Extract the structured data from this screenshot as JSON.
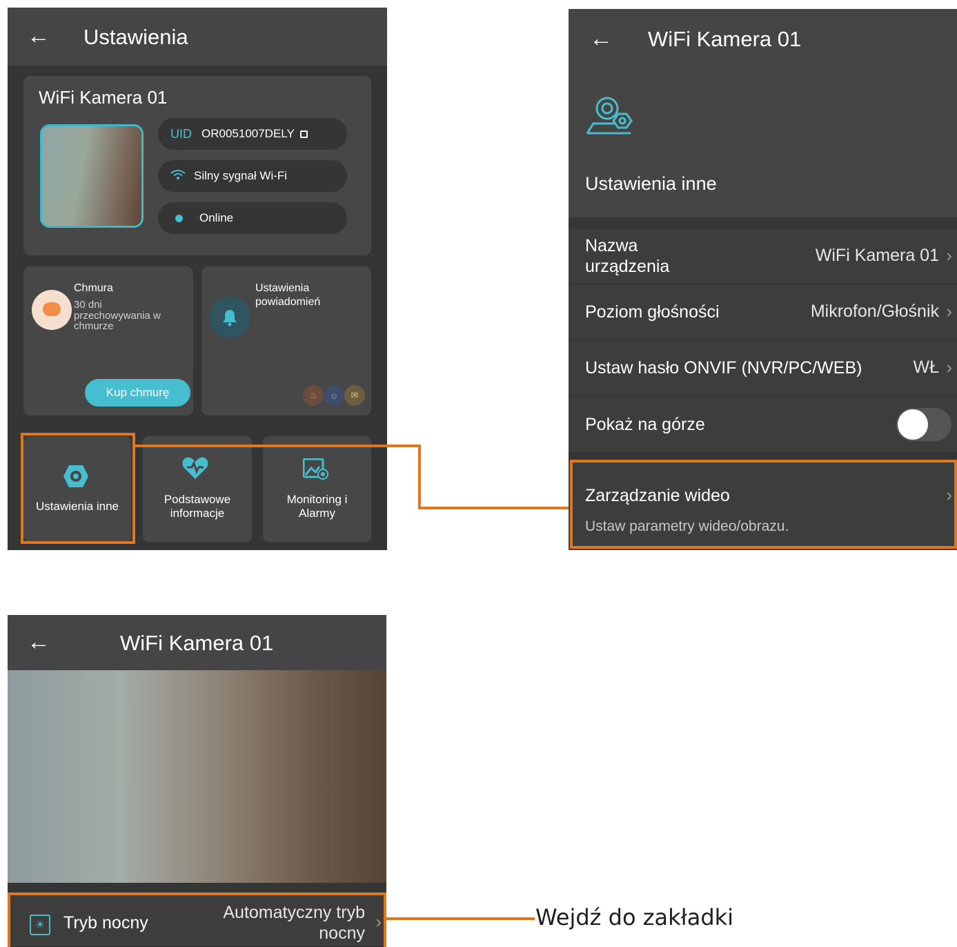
{
  "panel_settings": {
    "title": "Ustawienia",
    "device_name": "WiFi Kamera 01",
    "uid_label": "UID",
    "uid_value": "OR0051007DELY",
    "wifi_status": "Silny sygnał Wi-Fi",
    "online_status": "Online",
    "cloud_title": "Chmura",
    "cloud_desc_1": "30 dni",
    "cloud_desc_2": "przechowywania w",
    "cloud_desc_3": "chmurze",
    "buy_cloud": "Kup chmurę",
    "notif_title_1": "Ustawienia",
    "notif_title_2": "powiadomień",
    "tiles": [
      {
        "label_1": "Ustawienia inne",
        "label_2": ""
      },
      {
        "label_1": "Podstawowe",
        "label_2": "informacje"
      },
      {
        "label_1": "Monitoring i",
        "label_2": "Alarmy"
      }
    ]
  },
  "panel_other": {
    "title": "WiFi Kamera 01",
    "section_title": "Ustawienia inne",
    "rows": [
      {
        "label_1": "Nazwa",
        "label_2": "urządzenia",
        "value": "WiFi Kamera 01"
      },
      {
        "label": "Poziom głośności",
        "value": "Mikrofon/Głośnik"
      },
      {
        "label": "Ustaw hasło ONVIF (NVR/PC/WEB)",
        "value": "WŁ"
      },
      {
        "label": "Pokaż na górze",
        "toggle_on": false
      }
    ],
    "video_mgmt": {
      "label": "Zarządzanie wideo",
      "sub": "Ustaw parametry wideo/obrazu."
    }
  },
  "panel_video": {
    "title": "WiFi Kamera 01",
    "night_label": "Tryb nocny",
    "night_value_1": "Automatyczny tryb",
    "night_value_2": "nocny"
  },
  "callout_text": "Wejdź do zakładki",
  "colors": {
    "accent": "#46bed0",
    "highlight": "#e2761c",
    "panel_bg": "#353535",
    "card_bg": "#474747"
  }
}
